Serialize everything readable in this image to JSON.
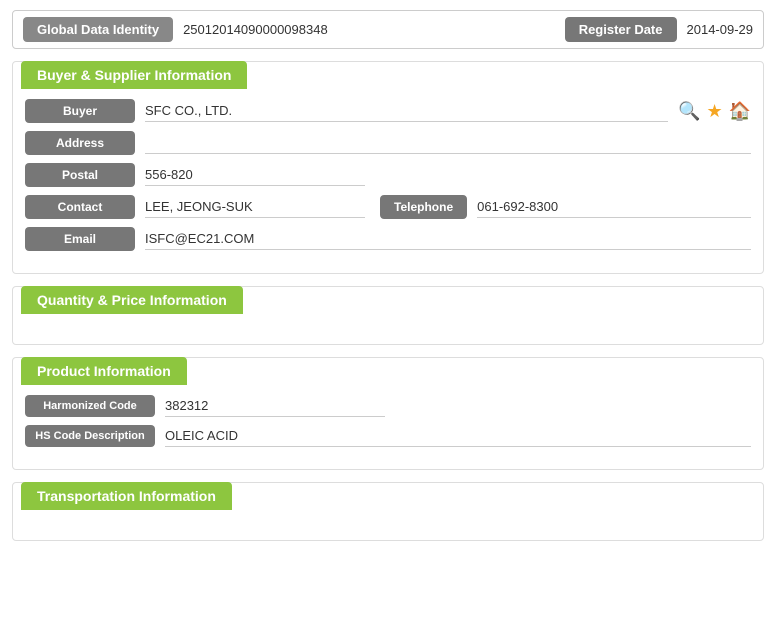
{
  "header": {
    "global_label": "Global Data Identity",
    "global_value": "25012014090000098348",
    "register_label": "Register Date",
    "register_value": "2014-09-29"
  },
  "buyer_supplier": {
    "section_title": "Buyer & Supplier Information",
    "buyer_label": "Buyer",
    "buyer_value": "SFC CO., LTD.",
    "address_label": "Address",
    "address_value": "",
    "postal_label": "Postal",
    "postal_value": "556-820",
    "contact_label": "Contact",
    "contact_value": "LEE, JEONG-SUK",
    "telephone_label": "Telephone",
    "telephone_value": "061-692-8300",
    "email_label": "Email",
    "email_value": "ISFC@EC21.COM"
  },
  "quantity_price": {
    "section_title": "Quantity & Price Information"
  },
  "product": {
    "section_title": "Product Information",
    "harmonized_label": "Harmonized Code",
    "harmonized_value": "382312",
    "hs_desc_label": "HS Code Description",
    "hs_desc_value": "OLEIC ACID"
  },
  "transportation": {
    "section_title": "Transportation Information"
  },
  "icons": {
    "search": "🔍",
    "star": "★",
    "home": "🏠"
  }
}
